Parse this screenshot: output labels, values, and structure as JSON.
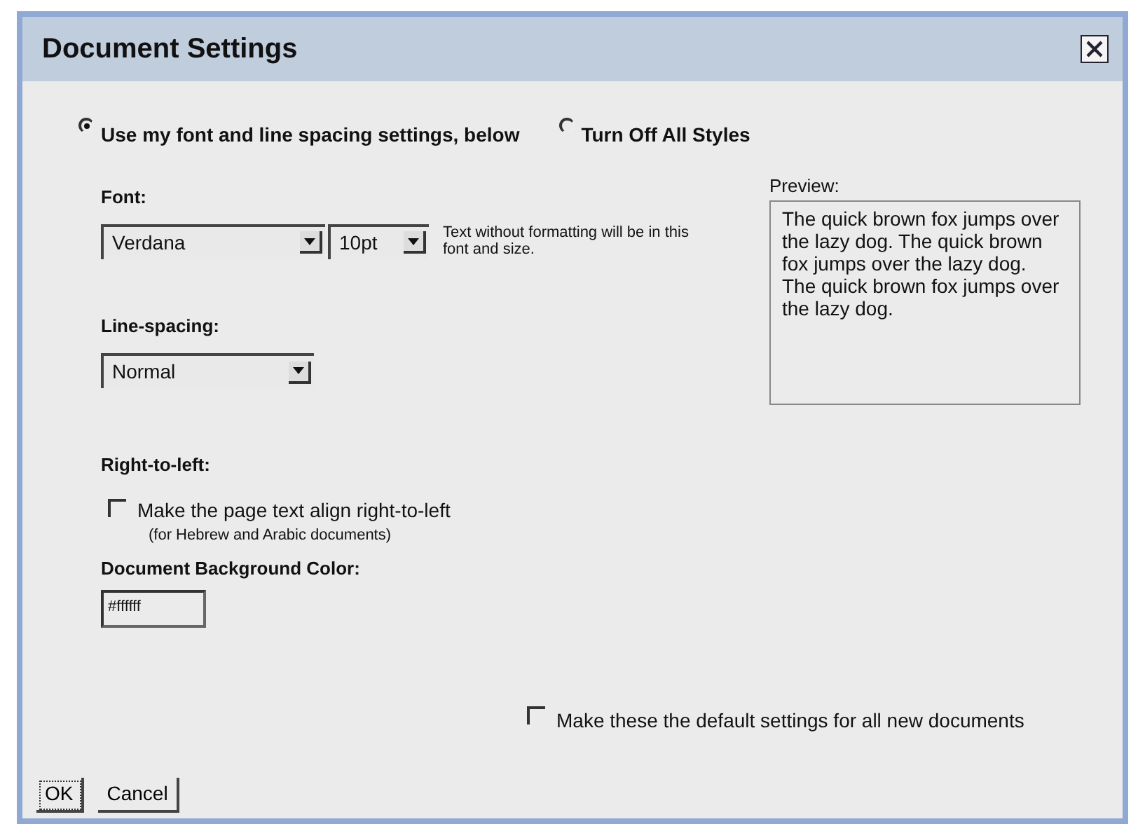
{
  "dialog": {
    "title": "Document Settings"
  },
  "style_mode": [
    {
      "label": "Use my font and line spacing settings, below",
      "selected": true
    },
    {
      "label": "Turn Off All Styles",
      "selected": false
    }
  ],
  "font": {
    "label": "Font:",
    "family": "Verdana",
    "size": "10pt",
    "hint": "Text without formatting will be in this font and size."
  },
  "preview": {
    "label": "Preview:",
    "text": "The quick brown fox jumps over the lazy dog. The quick brown fox jumps over the lazy dog. The quick brown fox jumps over the lazy dog."
  },
  "line_spacing": {
    "label": "Line-spacing:",
    "value": "Normal"
  },
  "right_to_left": {
    "label": "Right-to-left:",
    "option": {
      "label": "Make the page text align right-to-left",
      "note": "(for Hebrew and Arabic documents)",
      "checked": false
    }
  },
  "background_color": {
    "label": "Document Background Color:",
    "value": "#ffffff"
  },
  "default_option": {
    "label": "Make these the default settings for all new documents",
    "checked": false
  },
  "buttons": [
    {
      "label": "OK",
      "focused": true
    },
    {
      "label": "Cancel",
      "focused": false
    }
  ]
}
